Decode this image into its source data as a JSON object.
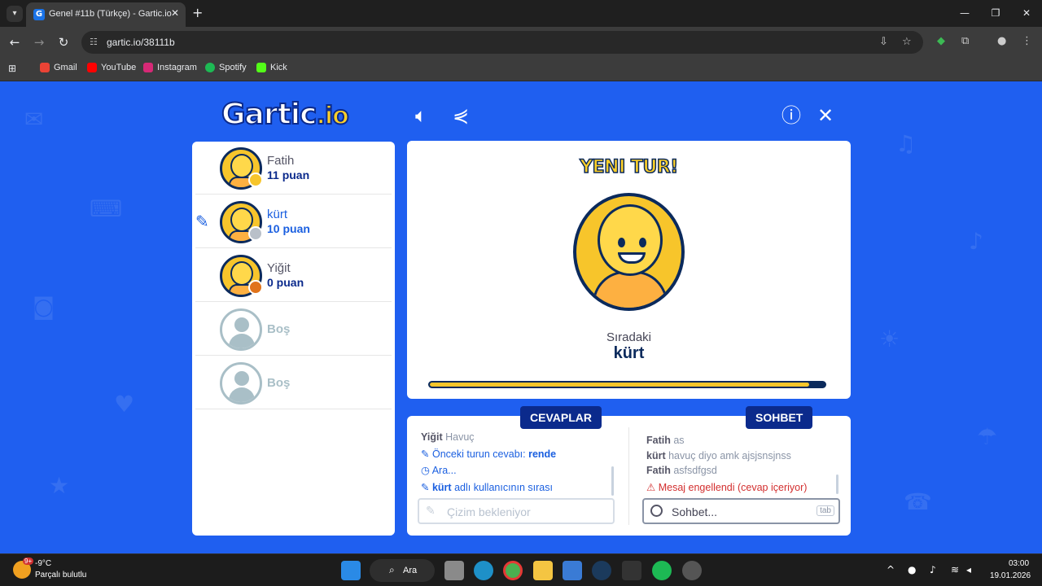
{
  "browser": {
    "tab_title": "Genel #11b (Türkçe) - Gartic.io",
    "url": "gartic.io/38111b",
    "bookmarks": [
      {
        "label": "Gmail",
        "color": "#ea4335"
      },
      {
        "label": "YouTube",
        "color": "#ff0000"
      },
      {
        "label": "Instagram",
        "color": "#d62976"
      },
      {
        "label": "Spotify",
        "color": "#1db954"
      },
      {
        "label": "Kick",
        "color": "#53fc18"
      }
    ]
  },
  "game": {
    "logo_text": "Gartic",
    "logo_suffix": ".io",
    "players": [
      {
        "name": "Fatih",
        "score": "11 puan",
        "badge_color": "#f7c52b"
      },
      {
        "name": "kürt",
        "score": "10 puan",
        "badge_color": "#b9c0c9",
        "drawing": true
      },
      {
        "name": "Yiğit",
        "score": "0 puan",
        "badge_color": "#e0731b"
      },
      {
        "name": "Boş"
      },
      {
        "name": "Boş"
      }
    ],
    "round_title": "YENI TUR!",
    "next_label": "Sıradaki",
    "next_player": "kürt",
    "progress": 0.96,
    "answers_tab": "CEVAPLAR",
    "chat_tab": "SOHBET",
    "answers": [
      {
        "author": "Yiğit",
        "text": "Havuç"
      },
      {
        "text": "Önceki turun cevabı: ",
        "bold": "rende"
      },
      {
        "text": "Ara..."
      },
      {
        "bold": "kürt",
        "text": " adlı kullanıcının sırası"
      }
    ],
    "answer_placeholder": "Çizim bekleniyor",
    "chat": [
      {
        "author": "Fatih",
        "text": "as"
      },
      {
        "author": "kürt",
        "text": "havuç diyo amk ajsjsnsjnss"
      },
      {
        "author": "Fatih",
        "text": "asfsdfgsd"
      },
      {
        "text": "Mesaj engellendi (cevap içeriyor)"
      }
    ],
    "chat_placeholder": "Sohbet...",
    "chat_key": "tab"
  },
  "taskbar": {
    "temperature": "-9°C",
    "weather": "Parçalı bulutlu",
    "weather_badge": "9+",
    "search_label": "Ara",
    "time": "03:00",
    "date": "19.01.2026"
  }
}
